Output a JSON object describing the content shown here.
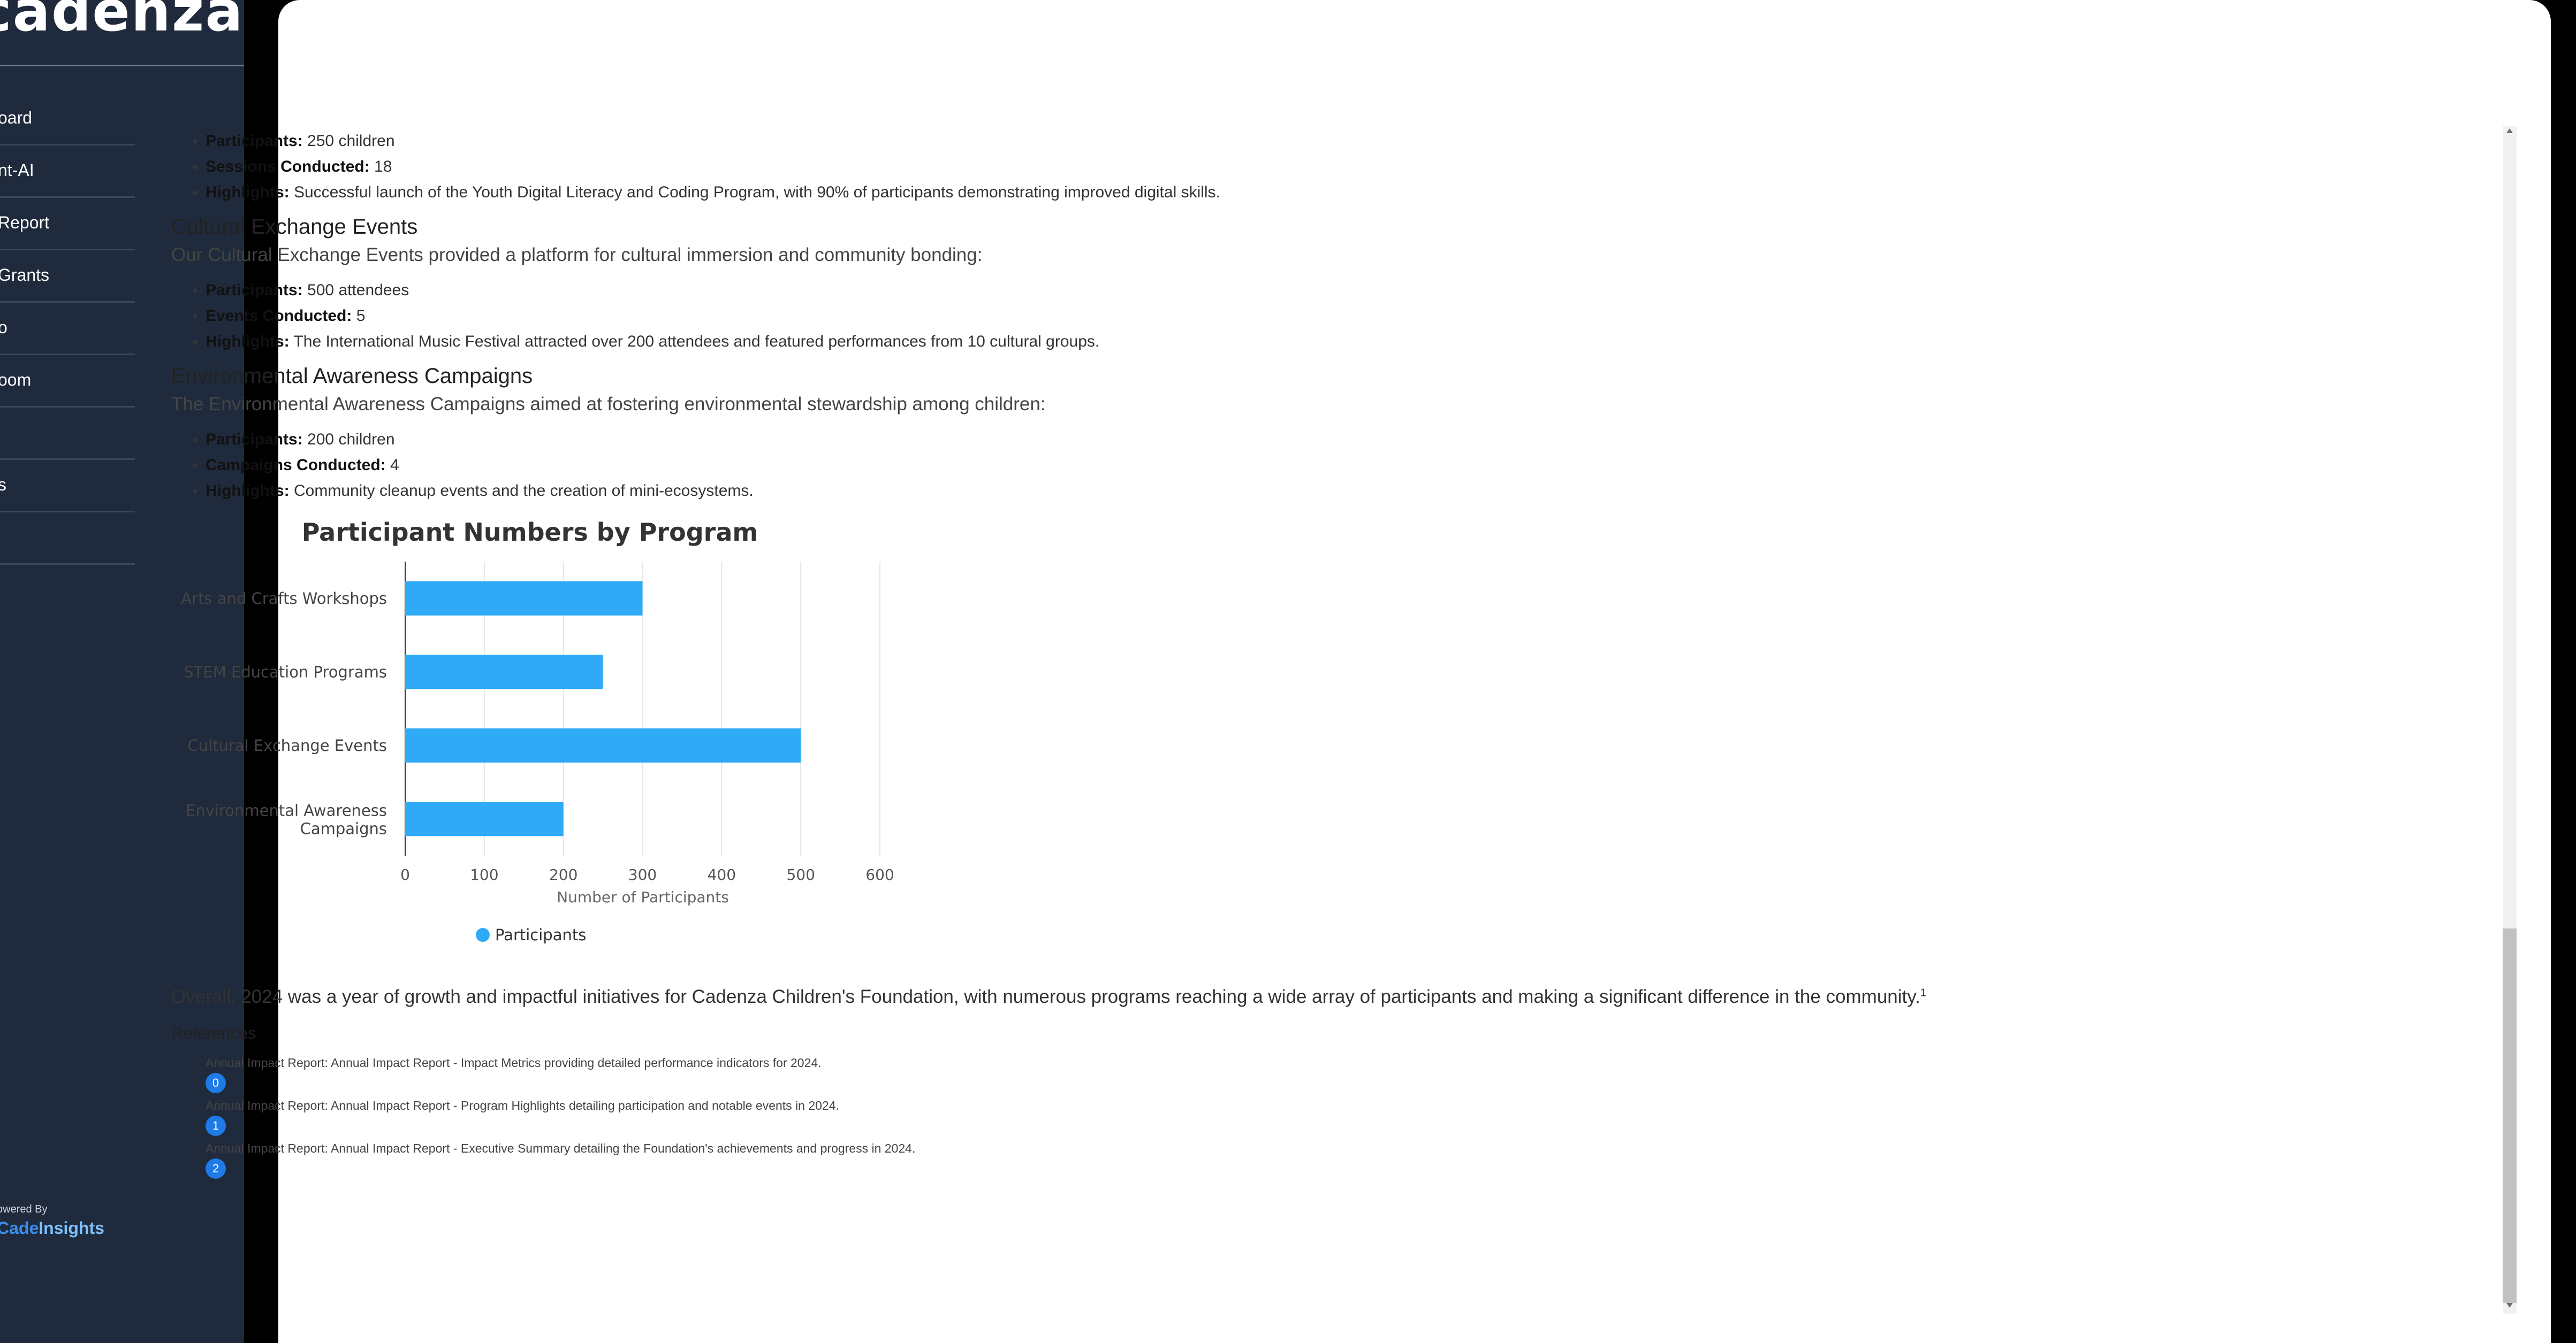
{
  "sidebar": {
    "brand": "cadenza",
    "items": [
      {
        "label": "oard"
      },
      {
        "label": "nt-AI"
      },
      {
        "label": " Report"
      },
      {
        "label": " Grants"
      },
      {
        "label": "o"
      },
      {
        "label": "oom"
      },
      {
        "label": ""
      },
      {
        "label": "s"
      },
      {
        "label": ""
      }
    ],
    "powered_by": "owered By",
    "powered_logo_a": "Cade",
    "powered_logo_b": "Insights"
  },
  "content": {
    "stem": {
      "participants_label": "Participants:",
      "participants_value": " 250 children",
      "sessions_label": "Sessions Conducted:",
      "sessions_value": " 18",
      "highlights_label": "Highlights:",
      "highlights_value": " Successful launch of the Youth Digital Literacy and Coding Program, with 90% of participants demonstrating improved digital skills."
    },
    "cultural": {
      "title": "Cultural Exchange Events",
      "intro": "Our Cultural Exchange Events provided a platform for cultural immersion and community bonding:",
      "participants_label": "Participants:",
      "participants_value": " 500 attendees",
      "events_label": "Events Conducted:",
      "events_value": " 5",
      "highlights_label": "Highlights:",
      "highlights_value": " The International Music Festival attracted over 200 attendees and featured performances from 10 cultural groups."
    },
    "environment": {
      "title": "Environmental Awareness Campaigns",
      "intro": "The Environmental Awareness Campaigns aimed at fostering environmental stewardship among children:",
      "participants_label": "Participants:",
      "participants_value": " 200 children",
      "campaigns_label": "Campaigns Conducted:",
      "campaigns_value": " 4",
      "highlights_label": "Highlights:",
      "highlights_value": " Community cleanup events and the creation of mini-ecosystems."
    },
    "summary": "Overall, 2024 was a year of growth and impactful initiatives for Cadenza Children's Foundation, with numerous programs reaching a wide array of participants and making a significant difference in the community.",
    "summary_sup": "1",
    "references_title": "References",
    "references": [
      {
        "text": "Annual Impact Report: Annual Impact Report - Impact Metrics providing detailed performance indicators for 2024.",
        "badge": "0"
      },
      {
        "text": "Annual Impact Report: Annual Impact Report - Program Highlights detailing participation and notable events in 2024.",
        "badge": "1"
      },
      {
        "text": "Annual Impact Report: Annual Impact Report - Executive Summary detailing the Foundation's achievements and progress in 2024.",
        "badge": "2"
      }
    ]
  },
  "chart_data": {
    "type": "bar",
    "orientation": "horizontal",
    "title": "Participant Numbers by Program",
    "categories": [
      "Arts and Crafts Workshops",
      "STEM Education Programs",
      "Cultural Exchange Events",
      "Environmental Awareness Campaigns"
    ],
    "series": [
      {
        "name": "Participants",
        "values": [
          300,
          250,
          500,
          200
        ],
        "color": "#2eaaf7"
      }
    ],
    "xlabel": "Number of Participants",
    "ylabel": "",
    "xlim": [
      0,
      600
    ],
    "xticks": [
      "0",
      "100",
      "200",
      "300",
      "400",
      "500",
      "600"
    ],
    "grid": "vertical",
    "legend": "bottom"
  }
}
